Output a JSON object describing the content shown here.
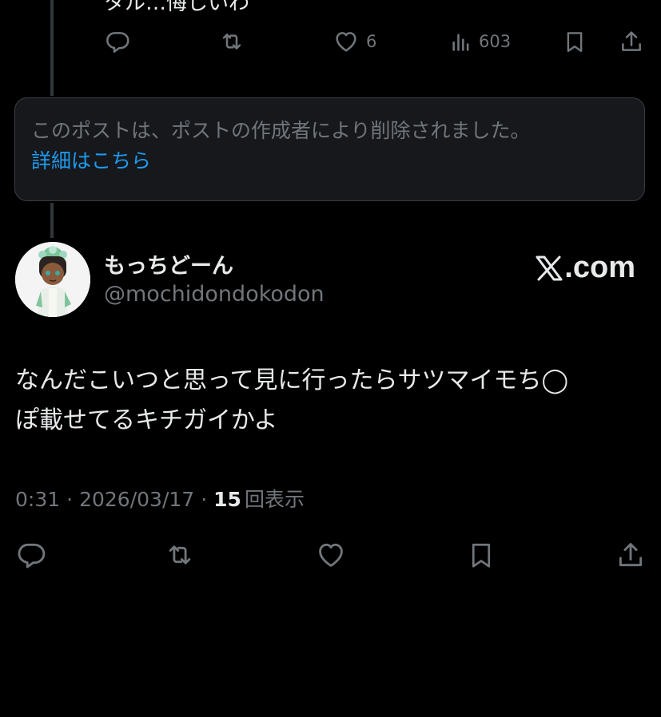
{
  "previous_post": {
    "text_fragment": "タル…悔しいわ",
    "actions": {
      "like_count": "6",
      "views_count": "603"
    }
  },
  "deleted_notice": {
    "message": "このポストは、ポストの作成者により削除されました。",
    "link": "詳細はこちら"
  },
  "post": {
    "author": {
      "display_name": "もっちどーん",
      "handle": "@mochidondokodon"
    },
    "brand": {
      "x_glyph": "𝕏",
      "suffix": ".com"
    },
    "text_lines": [
      "なんだこいつと思って見に行ったらサツマイモち◯",
      "ぽ載せてるキチガイかよ"
    ],
    "time": "0:31",
    "date": "2026/03/17",
    "separator": "·",
    "views_count": "15",
    "views_label": "回表示"
  },
  "icons": [
    "reply-icon",
    "retweet-icon",
    "like-icon",
    "views-icon",
    "bookmark-icon",
    "share-icon"
  ],
  "colors": {
    "background": "#000000",
    "text_primary": "#e7e9ea",
    "text_secondary": "#71767b",
    "link": "#1d9bf0",
    "notice_bg": "#16181c",
    "thread_line": "#333639"
  }
}
